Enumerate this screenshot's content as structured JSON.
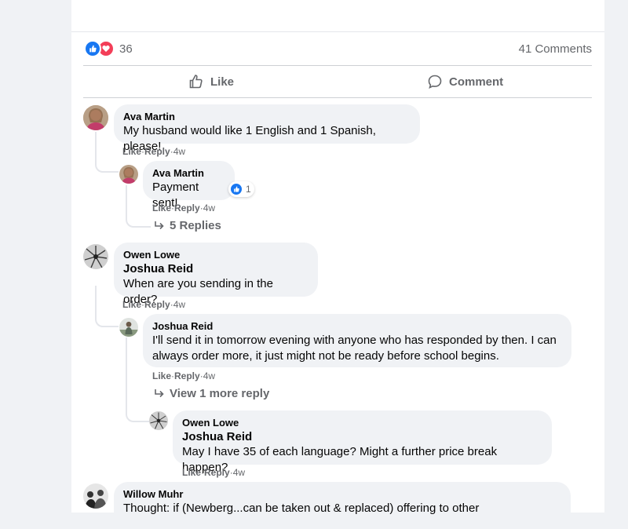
{
  "post_footer": {
    "reaction_count": "36",
    "comments_count": "41 Comments",
    "like_label": "Like",
    "comment_label": "Comment"
  },
  "colors": {
    "accent": "#1877f2",
    "love": "#f33e58",
    "muted": "#65676b",
    "bubble": "#f0f2f5"
  },
  "comments": [
    {
      "author": "Ava Martin",
      "text": "My husband would like 1 English and 1 Spanish, please!",
      "actions": {
        "like": "Like",
        "reply": "Reply",
        "time": "4w"
      },
      "replies": [
        {
          "author": "Ava Martin",
          "text": "Payment sent!",
          "reaction_count": "1",
          "actions": {
            "like": "Like",
            "reply": "Reply",
            "time": "4w"
          }
        }
      ],
      "more_replies": "5 Replies"
    },
    {
      "author": "Owen Lowe",
      "mention": "Joshua Reid",
      "text": "When are you sending in the order?",
      "actions": {
        "like": "Like",
        "reply": "Reply",
        "time": "4w"
      },
      "replies": [
        {
          "author": "Joshua Reid",
          "text": "I'll send it in tomorrow evening with anyone who has responded by then. I can always order more, it just might not be ready before school begins.",
          "actions": {
            "like": "Like",
            "reply": "Reply",
            "time": "4w"
          }
        },
        {
          "author": "Owen Lowe",
          "mention": "Joshua Reid",
          "text": "May I have 35 of each language? Might a further price break happen?",
          "actions": {
            "like": "Like",
            "reply": "Reply",
            "time": "4w"
          }
        }
      ],
      "more_replies": "View 1 more reply"
    },
    {
      "author": "Willow Muhr",
      "text": "Thought: if (Newberg...can be taken out & replaced) offering to other"
    }
  ],
  "separator": " · "
}
